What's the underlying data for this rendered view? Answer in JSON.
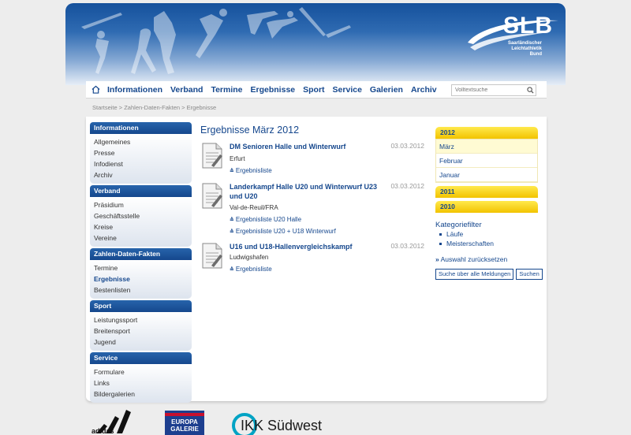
{
  "header": {
    "logo_text": "SLB",
    "logo_subtitle": "Saarländischer Leichtathletik Bund"
  },
  "nav": {
    "items": [
      "Informationen",
      "Verband",
      "Termine",
      "Ergebnisse",
      "Sport",
      "Service",
      "Galerien",
      "Archiv"
    ],
    "search_placeholder": "Volltextsuche"
  },
  "breadcrumb": "Startseite > Zahlen-Daten-Fakten > Ergebnisse",
  "sidebar": {
    "sections": [
      {
        "title": "Informationen",
        "items": [
          "Allgemeines",
          "Presse",
          "Infodienst",
          "Archiv"
        ]
      },
      {
        "title": "Verband",
        "items": [
          "Präsidium",
          "Geschäftsstelle",
          "Kreise",
          "Vereine"
        ]
      },
      {
        "title": "Zahlen-Daten-Fakten",
        "items": [
          "Termine",
          "Ergebnisse",
          "Bestenlisten"
        ]
      },
      {
        "title": "Sport",
        "items": [
          "Leistungssport",
          "Breitensport",
          "Jugend"
        ]
      },
      {
        "title": "Service",
        "items": [
          "Formulare",
          "Links",
          "Bildergalerien"
        ]
      }
    ]
  },
  "main": {
    "title": "Ergebnisse März 2012",
    "entries": [
      {
        "title": "DM Senioren Halle und Winterwurf",
        "date": "03.03.2012",
        "location": "Erfurt",
        "links": [
          "Ergebnisliste"
        ]
      },
      {
        "title": "Landerkampf Halle U20 und Winterwurf U23 und U20",
        "date": "03.03.2012",
        "location": "Val-de-Reuil/FRA",
        "links": [
          "Ergebnisliste U20 Halle",
          "Ergebnisliste U20 + U18 Winterwurf"
        ]
      },
      {
        "title": "U16 und U18-Hallenvergleichskampf",
        "date": "03.03.2012",
        "location": "Ludwigshafen",
        "links": [
          "Ergebnisliste"
        ]
      }
    ]
  },
  "archive": {
    "years": [
      {
        "year": "2012",
        "months": [
          "März",
          "Februar",
          "Januar"
        ]
      },
      {
        "year": "2011",
        "months": []
      },
      {
        "year": "2010",
        "months": []
      }
    ],
    "kategorie_title": "Kategoriefilter",
    "kategorien": [
      "Läufe",
      "Meisterschaften"
    ],
    "reset_label": "Auswahl zurücksetzen",
    "search_all_label": "Suche über alle Meldungen",
    "search_label": "Suchen"
  },
  "sponsors": {
    "items": [
      "adidas",
      "EUROPA GALERIE",
      "IKK Südwest"
    ]
  },
  "colors": {
    "brand_blue": "#15478d",
    "accent_yellow": "#f2c300"
  }
}
